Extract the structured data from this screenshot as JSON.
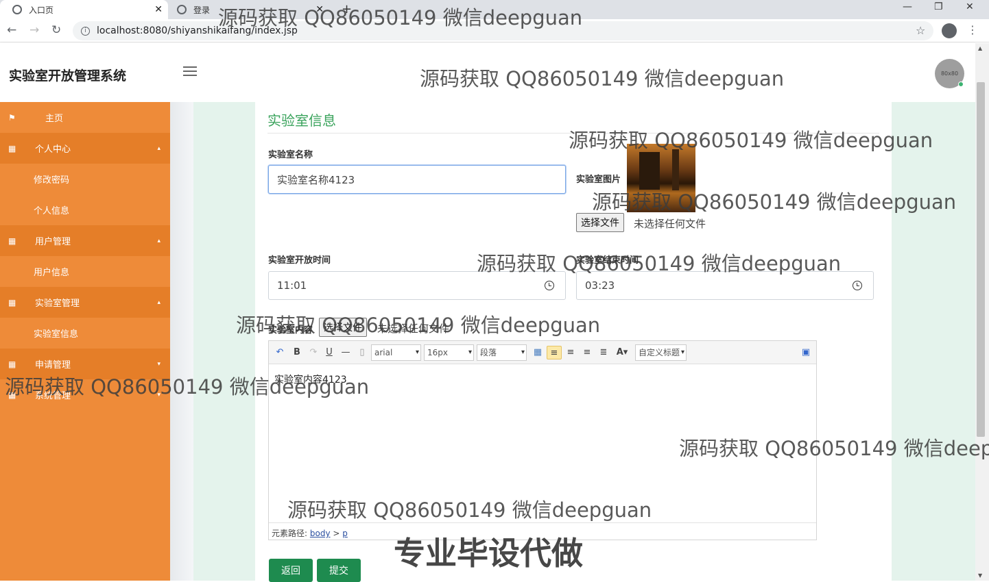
{
  "browser": {
    "tabs": [
      {
        "label": "入口页"
      },
      {
        "label": "登录"
      }
    ],
    "url": "localhost:8080/shiyanshikaifang/index.jsp"
  },
  "header": {
    "brand": "实验室开放管理系统",
    "avatar_text": "80x80"
  },
  "sidebar": {
    "items": [
      {
        "label": "主页",
        "type": "item"
      },
      {
        "label": "个人中心",
        "type": "group",
        "expanded": true
      },
      {
        "label": "修改密码",
        "type": "sub"
      },
      {
        "label": "个人信息",
        "type": "sub"
      },
      {
        "label": "用户管理",
        "type": "group",
        "expanded": true
      },
      {
        "label": "用户信息",
        "type": "sub"
      },
      {
        "label": "实验室管理",
        "type": "group",
        "expanded": true
      },
      {
        "label": "实验室信息",
        "type": "sub"
      },
      {
        "label": "申请管理",
        "type": "group",
        "expanded": false
      },
      {
        "label": "系统管理",
        "type": "group",
        "expanded": false
      }
    ]
  },
  "form": {
    "title": "实验室信息",
    "name_label": "实验室名称",
    "name_value": "实验室名称4123",
    "image_label": "实验室图片",
    "file_button": "选择文件",
    "file_status": "未选择任何文件",
    "open_time_label": "实验室开放时间",
    "open_time_value": "11:01",
    "end_time_label": "实验室结束时间",
    "end_time_value": "03:23",
    "content_label": "实验室内容",
    "content_file_button": "选择文件",
    "content_file_status": "未选择任何文件",
    "editor": {
      "font": "arial",
      "size": "16px",
      "paragraph": "段落",
      "custom_title": "自定义标题",
      "content": "实验室内容4123",
      "path_label": "元素路径:",
      "path_body": "body",
      "path_sep": " > ",
      "path_p": "p"
    },
    "back_button": "返回",
    "submit_button": "提交"
  },
  "watermarks": {
    "text": "源码获取 QQ86050149 微信deepguan",
    "text_cut": "源码获取 QQ86050149 微信deep",
    "big": "专业毕设代做"
  },
  "colors": {
    "sidebar": "#ee8b39",
    "accent_green": "#3aa35c",
    "button_green": "#1e8b4f"
  }
}
